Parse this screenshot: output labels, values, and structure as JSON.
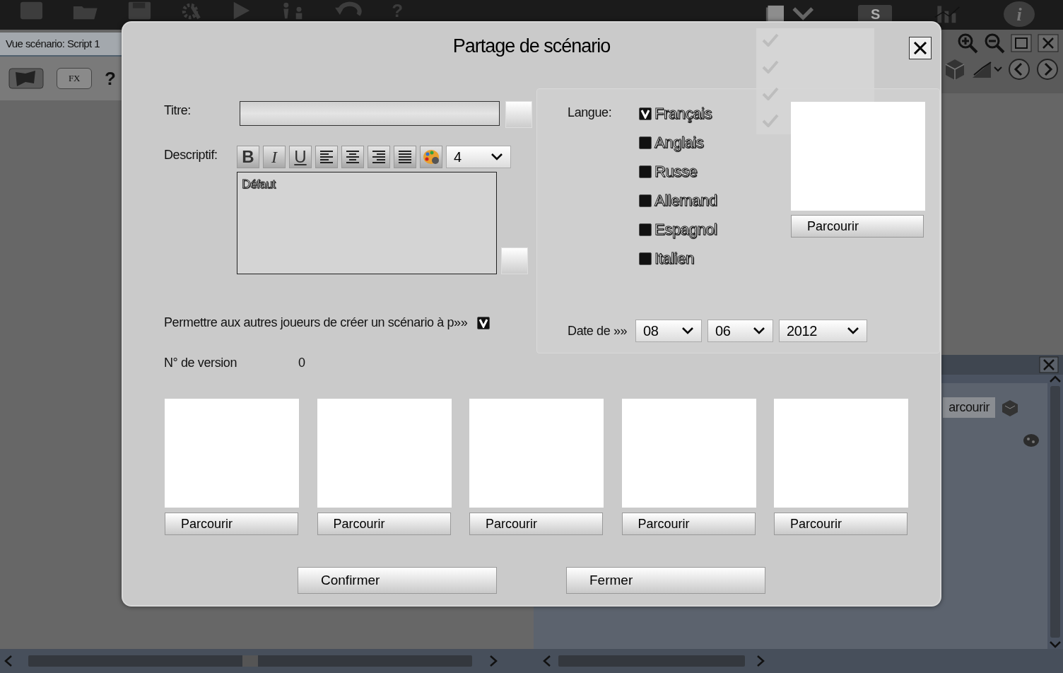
{
  "app": {
    "top_toolbar": [
      {
        "kind": "new"
      },
      {
        "kind": "open"
      },
      {
        "kind": "save"
      },
      {
        "kind": "settings"
      },
      {
        "kind": "play"
      },
      {
        "kind": "users"
      },
      {
        "kind": "undo"
      },
      {
        "kind": "help",
        "label": "?"
      }
    ],
    "top_toolbar_right": [
      {
        "kind": "document"
      },
      {
        "kind": "folder_add",
        "label": "S"
      },
      {
        "kind": "chart"
      },
      {
        "kind": "info",
        "label": "i"
      }
    ],
    "panel_title": "Vue scénario: Script 1",
    "panel_tools": [
      {
        "kind": "flag"
      },
      {
        "kind": "fx",
        "label": "FX"
      },
      {
        "kind": "help",
        "label": "?"
      }
    ],
    "view_tools": [
      {
        "kind": "zoom_in"
      },
      {
        "kind": "zoom_out"
      },
      {
        "kind": "maximize"
      },
      {
        "kind": "close"
      }
    ],
    "nav_tools": [
      {
        "kind": "cube"
      },
      {
        "kind": "chart"
      },
      {
        "kind": "prev"
      },
      {
        "kind": "next"
      }
    ],
    "properties_button": "arcourir"
  },
  "dialog": {
    "title": "Partage de scénario",
    "title_field": {
      "label": "Titre:"
    },
    "description": {
      "label": "Descriptif:",
      "format_buttons": [
        {
          "kind": "bold",
          "label": "B"
        },
        {
          "kind": "italic",
          "label": "I"
        },
        {
          "kind": "underline",
          "label": "U"
        },
        {
          "kind": "align_left"
        },
        {
          "kind": "align_center"
        },
        {
          "kind": "align_right"
        },
        {
          "kind": "justify"
        },
        {
          "kind": "color"
        }
      ],
      "font_size": "4",
      "value": "Défaut"
    },
    "allow_derive": {
      "label": "Permettre aux autres joueurs de créer un scénario à p»»",
      "checked": true
    },
    "version": {
      "label": "N° de version",
      "value": "0"
    },
    "language": {
      "label": "Langue:",
      "options": [
        {
          "label": "Français",
          "checked": true
        },
        {
          "label": "Anglais",
          "checked": false
        },
        {
          "label": "Russe",
          "checked": false
        },
        {
          "label": "Allemand",
          "checked": false
        },
        {
          "label": "Espagnol",
          "checked": false
        },
        {
          "label": "Italien",
          "checked": false
        }
      ]
    },
    "cover": {
      "button": "Parcourir"
    },
    "date": {
      "label": "Date de »»",
      "day": "08",
      "month": "06",
      "year": "2012"
    },
    "screenshots": [
      {
        "button": "Parcourir"
      },
      {
        "button": "Parcourir"
      },
      {
        "button": "Parcourir"
      },
      {
        "button": "Parcourir"
      },
      {
        "button": "Parcourir"
      }
    ],
    "buttons": [
      {
        "label": "Confirmer"
      },
      {
        "label": "Fermer"
      }
    ]
  }
}
